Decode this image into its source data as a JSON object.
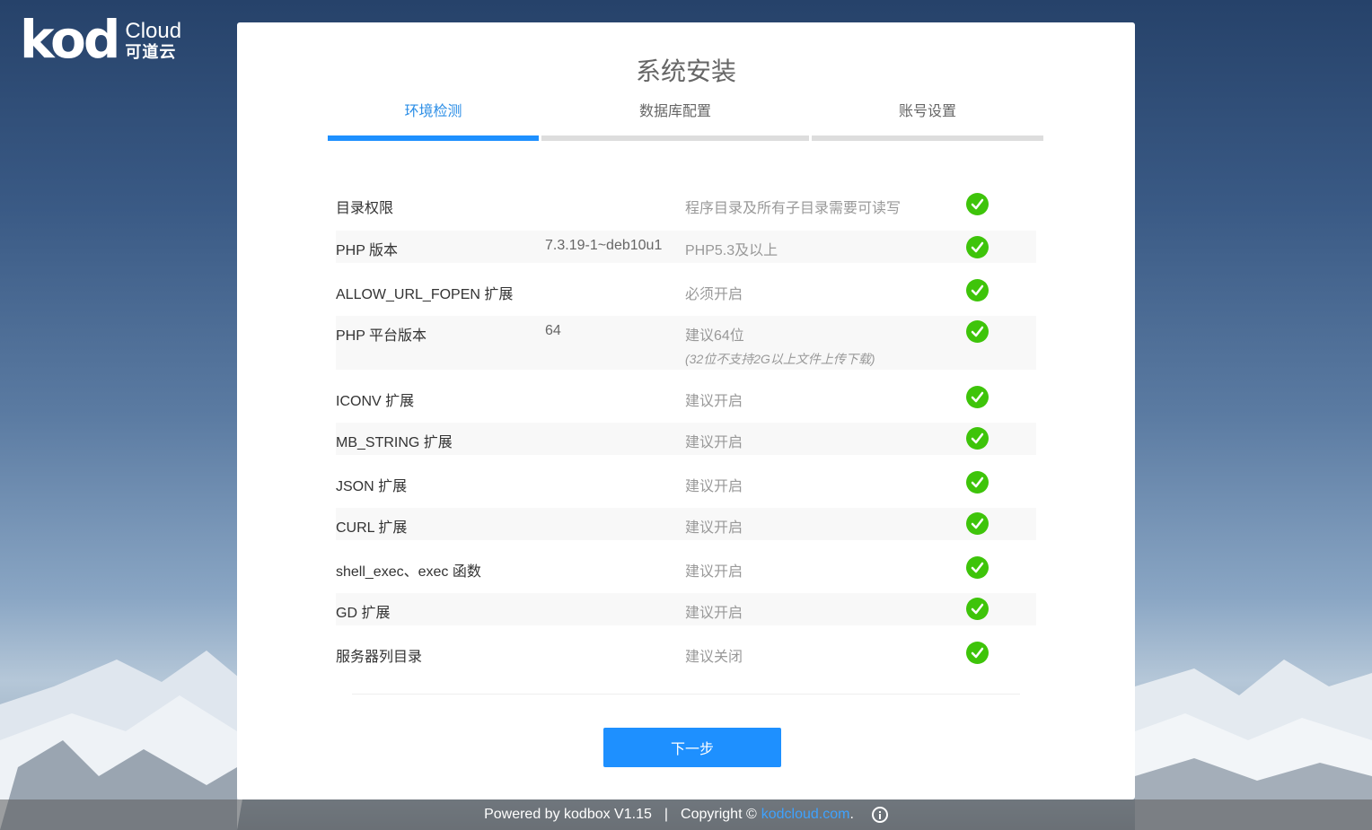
{
  "logo": {
    "kod": "kod",
    "cloud": "Cloud",
    "cn": "可道云"
  },
  "panel": {
    "title": "系统安装"
  },
  "steps": [
    {
      "label": "环境检测",
      "active": true
    },
    {
      "label": "数据库配置",
      "active": false
    },
    {
      "label": "账号设置",
      "active": false
    }
  ],
  "checks": [
    {
      "name": "目录权限",
      "value": "",
      "requirement": "程序目录及所有子目录需要可读写",
      "note": "",
      "status": "ok"
    },
    {
      "name": "PHP 版本",
      "value": "7.3.19-1~deb10u1",
      "requirement": "PHP5.3及以上",
      "note": "",
      "status": "ok"
    },
    {
      "name": "ALLOW_URL_FOPEN 扩展",
      "value": "",
      "requirement": "必须开启",
      "note": "",
      "status": "ok"
    },
    {
      "name": "PHP 平台版本",
      "value": "64",
      "requirement": "建议64位",
      "note": "(32位不支持2G以上文件上传下载)",
      "status": "ok"
    },
    {
      "name": "ICONV 扩展",
      "value": "",
      "requirement": "建议开启",
      "note": "",
      "status": "ok"
    },
    {
      "name": "MB_STRING 扩展",
      "value": "",
      "requirement": "建议开启",
      "note": "",
      "status": "ok"
    },
    {
      "name": "JSON 扩展",
      "value": "",
      "requirement": "建议开启",
      "note": "",
      "status": "ok"
    },
    {
      "name": "CURL 扩展",
      "value": "",
      "requirement": "建议开启",
      "note": "",
      "status": "ok"
    },
    {
      "name": "shell_exec、exec 函数",
      "value": "",
      "requirement": "建议开启",
      "note": "",
      "status": "ok"
    },
    {
      "name": "GD 扩展",
      "value": "",
      "requirement": "建议开启",
      "note": "",
      "status": "ok"
    },
    {
      "name": "服务器列目录",
      "value": "",
      "requirement": "建议关闭",
      "note": "",
      "status": "ok"
    }
  ],
  "next_button": "下一步",
  "footer": {
    "powered": "Powered by kodbox V1.15",
    "separator": "|",
    "copyright": "Copyright ©",
    "link": "kodcloud.com",
    "period": "."
  },
  "colors": {
    "accent": "#1e90ff",
    "success": "#3ec40a"
  },
  "icons": {
    "status_ok": "check-circle-icon",
    "info": "info-icon"
  }
}
